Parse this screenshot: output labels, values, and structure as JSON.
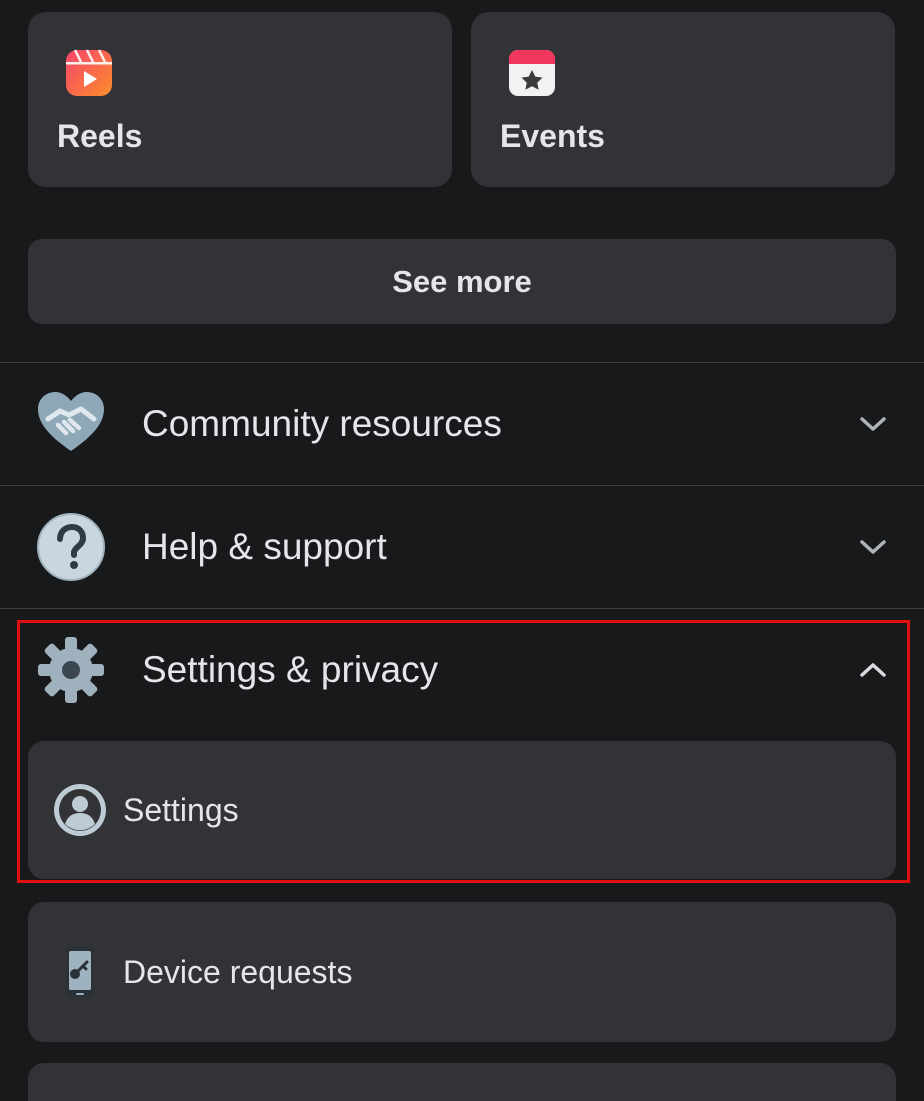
{
  "shortcuts": {
    "reels": {
      "label": "Reels",
      "icon": "reels-icon"
    },
    "events": {
      "label": "Events",
      "icon": "calendar-star-icon"
    }
  },
  "see_more_label": "See more",
  "sections": {
    "community": {
      "label": "Community resources",
      "icon": "handshake-heart-icon",
      "expanded": false
    },
    "help": {
      "label": "Help & support",
      "icon": "question-mark-icon",
      "expanded": false
    },
    "settings_privacy": {
      "label": "Settings & privacy",
      "icon": "gear-icon",
      "expanded": true
    }
  },
  "settings_items": [
    {
      "label": "Settings",
      "icon": "user-circle-icon"
    },
    {
      "label": "Device requests",
      "icon": "phone-key-icon"
    }
  ],
  "colors": {
    "background": "#18191a",
    "card": "#323336",
    "text": "#e4e6eb",
    "highlight": "#e01010"
  }
}
